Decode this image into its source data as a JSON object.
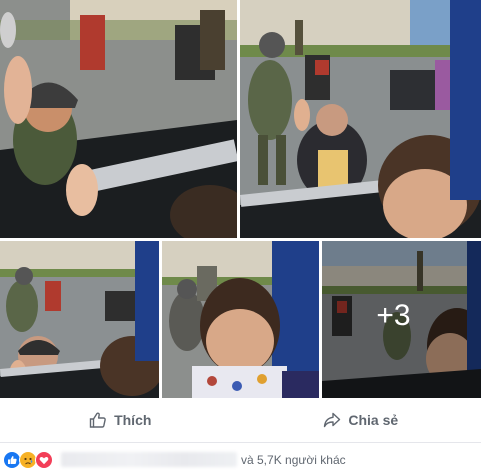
{
  "gallery": {
    "more_count_label": "+3"
  },
  "actions": {
    "like_label": "Thích",
    "share_label": "Chia sẻ"
  },
  "reactions": {
    "icons": [
      "like-icon",
      "sad-icon",
      "love-icon"
    ],
    "summary_text": "và 5,7K người khác"
  },
  "colors": {
    "like_blue": "#1877f2",
    "sad_yellow": "#f7b125",
    "love_red": "#f33e58",
    "action_gray": "#606770"
  }
}
